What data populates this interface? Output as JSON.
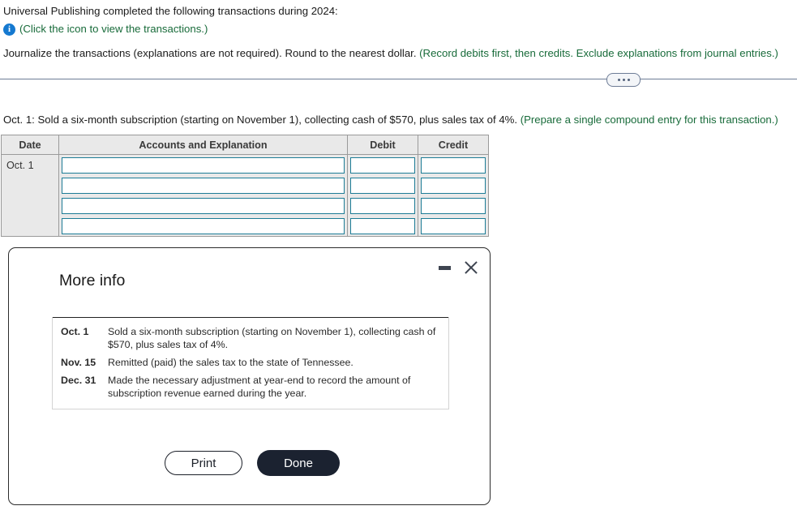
{
  "problem": {
    "intro": "Universal Publishing completed the following transactions during 2024:",
    "icon_hint": "(Click the icon to view the transactions.)",
    "instruction_plain": "Journalize the transactions (explanations are not required). Round to the nearest dollar. ",
    "instruction_hint": "(Record debits first, then credits. Exclude explanations from journal entries.)",
    "transaction_prompt_plain": "Oct. 1: Sold a six-month subscription (starting on November 1), collecting cash of $570, plus sales tax of 4%. ",
    "transaction_prompt_hint": "(Prepare a single compound entry for this transaction.)"
  },
  "journal": {
    "headers": {
      "date": "Date",
      "accounts": "Accounts and Explanation",
      "debit": "Debit",
      "credit": "Credit"
    },
    "date_value": "Oct. 1",
    "rows": [
      {
        "accounts": "",
        "debit": "",
        "credit": ""
      },
      {
        "accounts": "",
        "debit": "",
        "credit": ""
      },
      {
        "accounts": "",
        "debit": "",
        "credit": ""
      },
      {
        "accounts": "",
        "debit": "",
        "credit": ""
      }
    ]
  },
  "modal": {
    "title": "More info",
    "minimize_label": "minimize",
    "close_label": "close",
    "entries": [
      {
        "date": "Oct. 1",
        "description": "Sold a six-month subscription (starting on November 1), collecting cash of $570, plus sales tax of 4%."
      },
      {
        "date": "Nov. 15",
        "description": "Remitted (paid) the sales tax to the state of Tennessee."
      },
      {
        "date": "Dec. 31",
        "description": "Made the necessary adjustment at year-end to record the amount of subscription revenue earned during the year."
      }
    ],
    "print_label": "Print",
    "done_label": "Done"
  },
  "colors": {
    "hint_green": "#186b3a",
    "info_icon_blue": "#1579d0",
    "input_border_teal": "#1d7c96",
    "done_button": "#1b2230",
    "divider": "#6d7c96"
  }
}
